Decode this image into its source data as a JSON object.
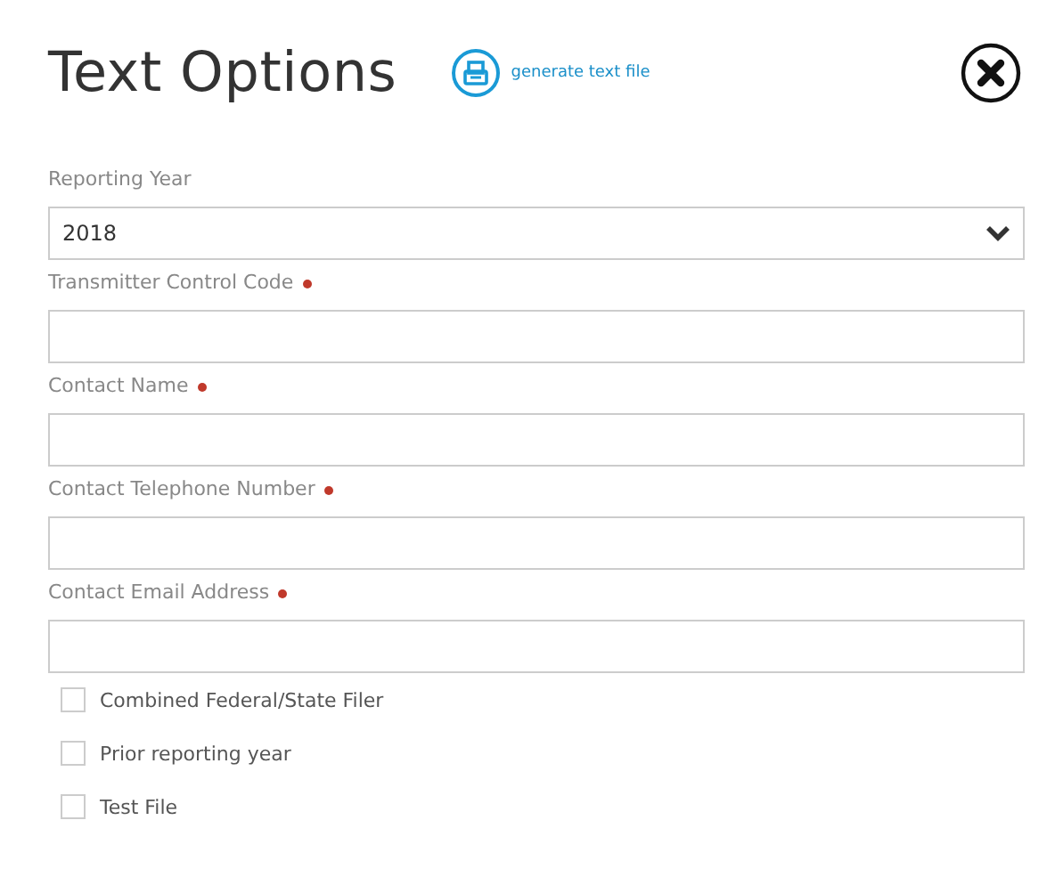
{
  "title": "Text Options",
  "action": {
    "label": "generate text file"
  },
  "fields": [
    {
      "kind": "select",
      "label": "Reporting Year",
      "value": "2018",
      "required": false
    },
    {
      "kind": "text",
      "label": "Transmitter Control Code",
      "required": true
    },
    {
      "kind": "text",
      "label": "Contact Name",
      "required": true
    },
    {
      "kind": "text",
      "label": "Contact Telephone Number",
      "required": true
    },
    {
      "kind": "text",
      "label": "Contact Email Address",
      "required": true
    }
  ],
  "checkboxes": [
    {
      "label": "Combined Federal/State Filer",
      "checked": false
    },
    {
      "label": "Prior reporting year",
      "checked": false
    },
    {
      "label": "Test File",
      "checked": false
    }
  ]
}
